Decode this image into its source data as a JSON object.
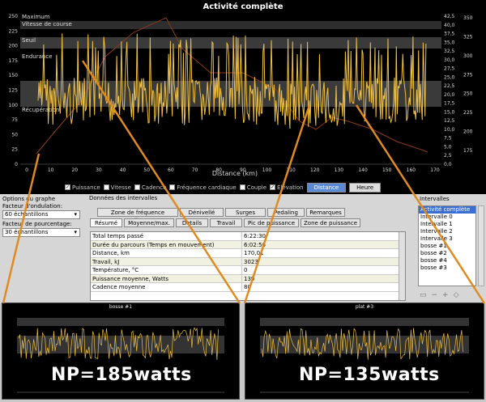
{
  "main_chart": {
    "title": "Activité complète",
    "xlabel": "Distance (km)",
    "x_ticks": [
      "0",
      "10",
      "20",
      "30",
      "40",
      "50",
      "60",
      "70",
      "80",
      "90",
      "100",
      "110",
      "120",
      "130",
      "140",
      "150",
      "160",
      "170"
    ],
    "y_left_ticks": [
      "0",
      "25",
      "50",
      "75",
      "100",
      "125",
      "150",
      "175",
      "200",
      "225",
      "250"
    ],
    "y_right1_ticks": [
      "0,0",
      "2,5",
      "5,0",
      "7,5",
      "10,0",
      "12,5",
      "15,0",
      "17,5",
      "20,0",
      "22,5",
      "25,0",
      "27,5",
      "30,0",
      "32,5",
      "35,0",
      "37,5",
      "40,0",
      "42,5"
    ],
    "y_right2_ticks": [
      "175",
      "200",
      "225",
      "250",
      "275",
      "300",
      "325",
      "350"
    ],
    "zones": [
      "Maximum",
      "Vitesse de course",
      "Seuil",
      "Endurance",
      "Récupération"
    ],
    "colors": {
      "power": "#f0c040",
      "hr": "#8a3a1a",
      "zone_band": "#3a3a3a"
    }
  },
  "legend": {
    "items": [
      "Puissance",
      "Vitesse",
      "Cadence",
      "Fréquence cardiaque",
      "Couple",
      "Élévation"
    ],
    "checked": [
      true,
      false,
      false,
      false,
      false,
      true
    ],
    "buttons": [
      "Distance",
      "Heure"
    ]
  },
  "options": {
    "title": "Options du graphe",
    "smoothing_label": "Facteur d'ondulation:",
    "smoothing_value": "60 échantillons",
    "percent_label": "Facteur de pourcentage:",
    "percent_value": "30 échantillons"
  },
  "intervals_data": {
    "title": "Données des intervalles",
    "tabs_row1": [
      "Zone de fréquence cardiaque",
      "Dénivellé",
      "Surges",
      "Pedaling",
      "Remarques"
    ],
    "tabs_row2": [
      "Résumé",
      "Moyenne/max.",
      "Details",
      "Travail",
      "Pic de puissance",
      "Zone de puissance"
    ],
    "rows": [
      {
        "k": "Total temps passé",
        "v": "6:22:30"
      },
      {
        "k": "Durée du parcours (Temps en mouvement)",
        "v": "6:02:56"
      },
      {
        "k": "Distance, km",
        "v": "170,01"
      },
      {
        "k": "Travail, kJ",
        "v": "3023"
      },
      {
        "k": "Température, °C",
        "v": "0"
      },
      {
        "k": "Puissance moyenne, Watts",
        "v": "139"
      },
      {
        "k": "Cadence moyenne",
        "v": "80"
      }
    ]
  },
  "interval_list": {
    "title": "Intervalles",
    "items": [
      "Activité complète",
      "Intervalle 0",
      "Intervalle 1",
      "Intervalle 2",
      "Intervalle 3",
      "bosse #1",
      "bosse #2",
      "bosse #4",
      "bosse #3"
    ]
  },
  "thumbs": [
    {
      "title": "bosse #1",
      "np": "NP=185watts"
    },
    {
      "title": "plat #3",
      "np": "NP=135watts"
    }
  ]
}
